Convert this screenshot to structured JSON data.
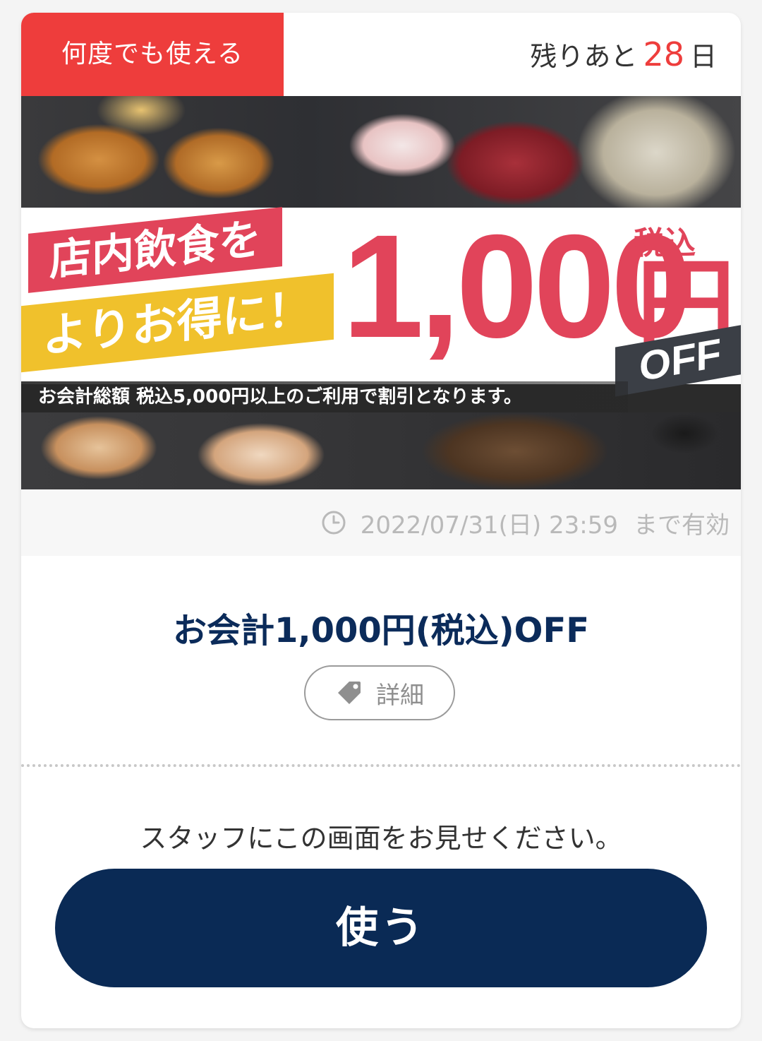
{
  "coupon": {
    "badge_label": "何度でも使える",
    "remaining_prefix": "残りあと",
    "remaining_days": "28",
    "remaining_suffix": "日",
    "banner": {
      "line1": "店内飲食を",
      "line2": "よりお得に！",
      "amount": "1,000",
      "yen": "円",
      "tax_note": "税込",
      "off_label": "OFF",
      "condition": "お会計総額 税込5,000円以上のご利用で割引となります。"
    },
    "expiry_date": "2022/07/31(日) 23:59",
    "expiry_suffix": "まで有効",
    "title": "お会計1,000円(税込)OFF",
    "details_label": "詳細",
    "instruction": "スタッフにこの画面をお見せください。",
    "use_label": "使う"
  },
  "colors": {
    "badge": "#ee3d3c",
    "accent_red": "#ee3d3c",
    "navy": "#0a2a55",
    "banner_pink": "#e1445a",
    "banner_yellow": "#f0c12c"
  },
  "icons": {
    "expiry": "clock-icon",
    "details": "tag-icon"
  }
}
